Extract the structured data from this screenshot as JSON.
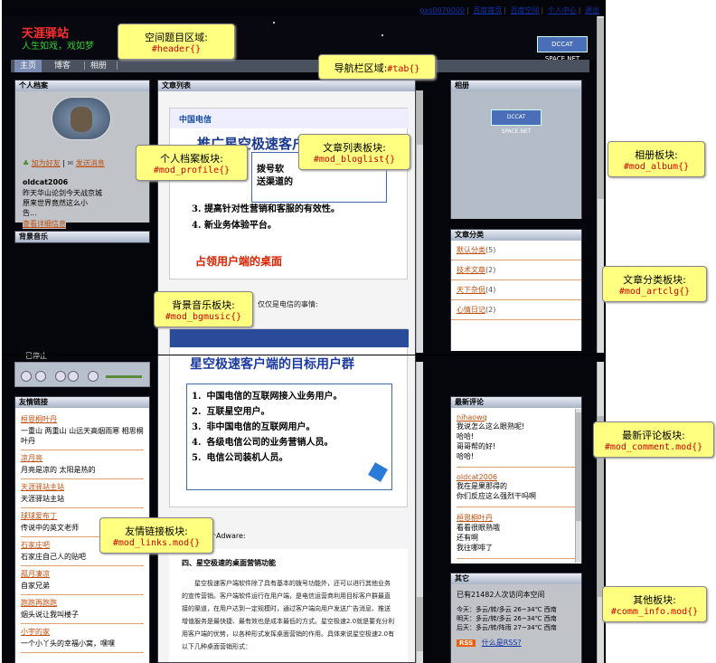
{
  "toplinks": {
    "user": "pxs0070000",
    "home": "百度首页",
    "space": "百度空间",
    "center": "个人中心",
    "logout": "退出"
  },
  "header": {
    "title": "天涯驿站",
    "subtitle": "人生如戏，戏如梦",
    "logo": "DCCAT SPACE.NET"
  },
  "tabs": {
    "home": "主页",
    "blog": "博客",
    "album": "相册"
  },
  "profile": {
    "title": "个人档案",
    "add_friend": "加为好友",
    "send_msg": "发送消息",
    "name": "oldcat2006",
    "line1": "昨天华山论剑今天战京城",
    "line2": "原来世界竟然这么小",
    "line3": "告...",
    "more": "查看详细信息"
  },
  "bgmusic": {
    "title": "背景音乐"
  },
  "player": {
    "label": "已停止"
  },
  "links": {
    "title": "友情链接",
    "items": [
      {
        "name": "桓恩桐叶丹",
        "desc": "一重山  两重山  山远天高烟雨寒  相思桐叶丹"
      },
      {
        "name": "凉月亮",
        "desc": "月亮是凉的  太阳是热的"
      },
      {
        "name": "天涯驿站主站",
        "desc": "天涯驿站主站"
      },
      {
        "name": "球球爱布丁",
        "desc": "传说中的英文老师"
      },
      {
        "name": "石家庄吧",
        "desc": "石家庄自己人的贴吧"
      },
      {
        "name": "孤月凄凉",
        "desc": "自家兄弟"
      },
      {
        "name": "跑跑再跑跑",
        "desc": "烟头说让我叫楼子"
      },
      {
        "name": "小宇的家",
        "desc": "一个小丫头的幸福小窝，嘿嘿"
      }
    ]
  },
  "bloglist": {
    "title": "文章列表",
    "slide1_title": "推广星空极速客户",
    "slide1_items": [
      "拨号软",
      "送渠道的",
      "提高针对性营销和客服的有效性。",
      "新业务体验平台。"
    ],
    "slide1_num3": "3.",
    "slide1_num4": "4.",
    "slide1_footer": "占领用户端的桌面",
    "slide1_logo": "中国电信",
    "mid_text": "仅仅是电信的事情:",
    "slide2_title": "星空极速客户端的目标用户群",
    "slide2_items": [
      "中国电信的互联网接入业务用户。",
      "互联星空用户。",
      "非中国电信的互联网用户。",
      "各级电信公司的业务营销人员。",
      "电信公司装机人员。"
    ],
    "slide2_nums": [
      "1.",
      "2.",
      "3.",
      "4.",
      "5."
    ],
    "adware_text": "个Adware:",
    "article_title": "四、星空极速的桌面营销功能",
    "article_body": "星空极速客户端软件除了具有基本的拨号功能外，还可以进行其他业务的宣传营销。客户端软件运行在用户端，是电信运营商利用目标客户群最直接的渠道，在用户达到一定规模时，通过客户端向用户发送广告消息、推送增值服务是最快捷、最有效也是成本最低的方式。星空极速2.0就是要充分利用客户端的优势，以各种形式发挥桌面营销的作用。具体来说星空极速2.0有以下几种桌面营销形式："
  },
  "album": {
    "title": "相册",
    "badge": "DCCAT SPACE.NET"
  },
  "categories": {
    "title": "文章分类",
    "items": [
      {
        "label": "默认分类",
        "count": "(5)"
      },
      {
        "label": "技术文章",
        "count": "(2)"
      },
      {
        "label": "天下杂侃",
        "count": "(4)"
      },
      {
        "label": "心情日记",
        "count": "(2)"
      }
    ]
  },
  "comments": {
    "title": "最新评论",
    "items": [
      {
        "name": "nihaowq",
        "lines": [
          "我说怎么这么眼熟呢!",
          "哈哈!",
          "哥哥帮的好!",
          "哈哈!"
        ]
      },
      {
        "name": "oldcat2006",
        "lines": [
          "我在是果那得的",
          "你们反应这么强烈干吗啊"
        ]
      },
      {
        "name": "桓恩桐叶丹",
        "lines": [
          "看看很眼熟哦",
          "还有啊",
          "我往哪啡了"
        ]
      }
    ]
  },
  "other": {
    "title": "其它",
    "visitors": "已有21482人次访问本空间",
    "weather": [
      "今天：多云/转/多云 26~34℃ 西南",
      "明天：多云/转/多云 26~34℃ 西南",
      "后天：多云/转/阵雨 27~34℃ 西南"
    ],
    "rss_badge": "RSS",
    "rss_link": "什么是RSS?"
  },
  "callouts": {
    "header": {
      "label": "空间题目区域:",
      "code": "#header{}"
    },
    "tab": {
      "label": "导航栏区域:",
      "code": "#tab{}"
    },
    "profile": {
      "label": "个人档案板块:",
      "code": "#mod_profile{}"
    },
    "bloglist": {
      "label": "文章列表板块:",
      "code": "#mod_bloglist{}"
    },
    "album": {
      "label": "相册板块:",
      "code": "#mod_album{}"
    },
    "artclg": {
      "label": "文章分类板块:",
      "code": "#mod_artclg{}"
    },
    "bgmusic": {
      "label": "背景音乐板块:",
      "code": "#mod_bgmusic{}"
    },
    "comment": {
      "label": "最新评论板块:",
      "code": "#mod_comment.mod{}"
    },
    "links": {
      "label": "友情链接板块:",
      "code": "#mod_links.mod{}"
    },
    "comm_info": {
      "label": "其他板块:",
      "code": "#comm_info.mod{}"
    }
  }
}
